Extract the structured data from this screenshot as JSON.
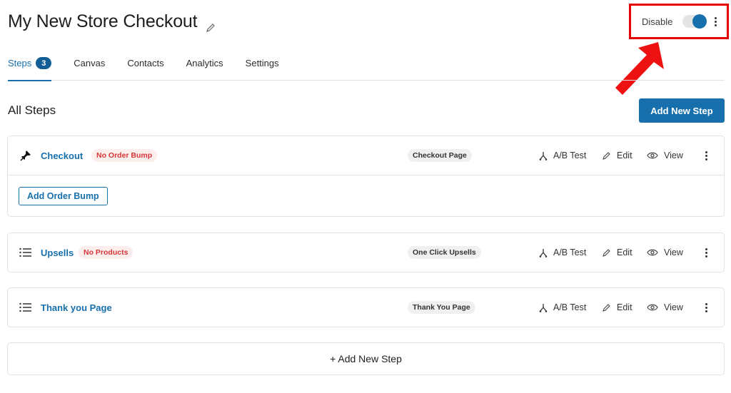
{
  "header": {
    "title": "My New Store Checkout",
    "status_label": "Disable",
    "toggle_on": true
  },
  "tabs": [
    {
      "label": "Steps",
      "count": "3",
      "active": true
    },
    {
      "label": "Canvas"
    },
    {
      "label": "Contacts"
    },
    {
      "label": "Analytics"
    },
    {
      "label": "Settings"
    }
  ],
  "section": {
    "title": "All Steps",
    "add_button": "Add New Step"
  },
  "steps": [
    {
      "icon": "pin-icon",
      "name": "Checkout",
      "warning": "No Order Bump",
      "type": "Checkout Page",
      "sub_button": "Add Order Bump"
    },
    {
      "icon": "list-icon",
      "name": "Upsells",
      "warning": "No Products",
      "type": "One Click Upsells"
    },
    {
      "icon": "list-icon",
      "name": "Thank you Page",
      "type": "Thank You Page"
    }
  ],
  "actions": {
    "ab_test": "A/B Test",
    "edit": "Edit",
    "view": "View"
  },
  "footer": {
    "add_step": "+ Add New Step"
  },
  "colors": {
    "accent": "#1770ac",
    "warning_text": "#d63638",
    "warning_bg": "#fdeeee",
    "highlight": "#e60000"
  }
}
